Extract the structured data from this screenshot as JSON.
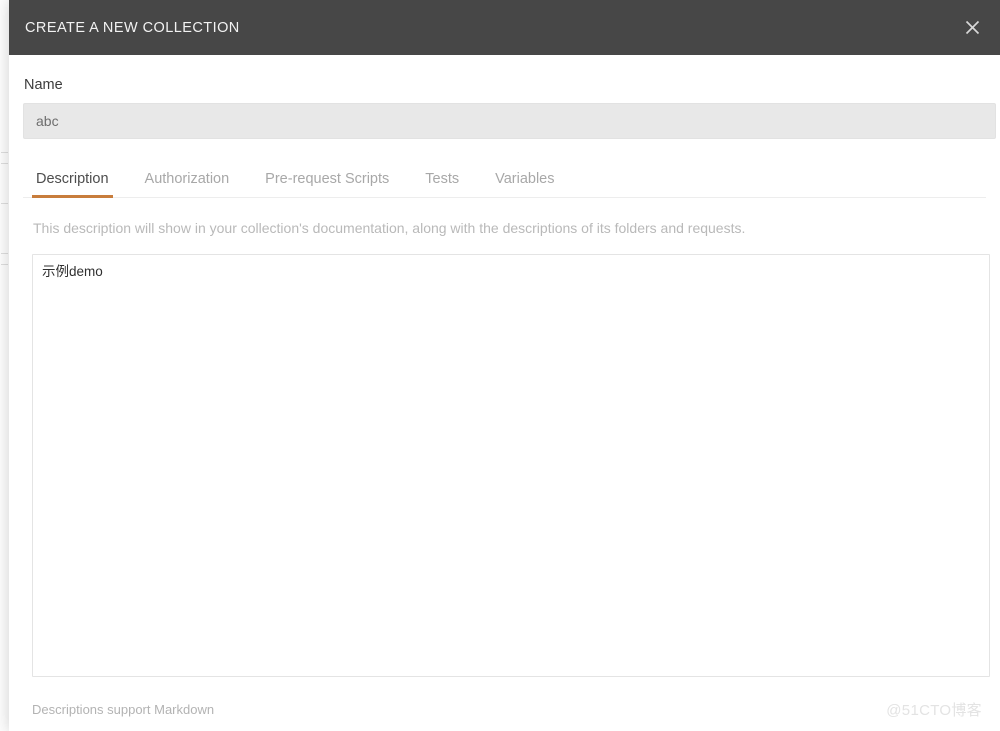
{
  "dialog": {
    "title": "CREATE A NEW COLLECTION",
    "close_icon": "close-icon",
    "accent_color": "#c87d3c",
    "header_bg": "#474747"
  },
  "name_field": {
    "label": "Name",
    "value": "abc",
    "placeholder": "abc"
  },
  "tabs": [
    {
      "label": "Description",
      "active": true
    },
    {
      "label": "Authorization",
      "active": false
    },
    {
      "label": "Pre-request Scripts",
      "active": false
    },
    {
      "label": "Tests",
      "active": false
    },
    {
      "label": "Variables",
      "active": false
    }
  ],
  "description_panel": {
    "helper_text": "This description will show in your collection's documentation, along with the descriptions of its folders and requests.",
    "textarea_value": "示例demo",
    "textarea_placeholder": ""
  },
  "footer": {
    "markdown_note": "Descriptions support Markdown",
    "watermark": "@51CTO博客"
  }
}
